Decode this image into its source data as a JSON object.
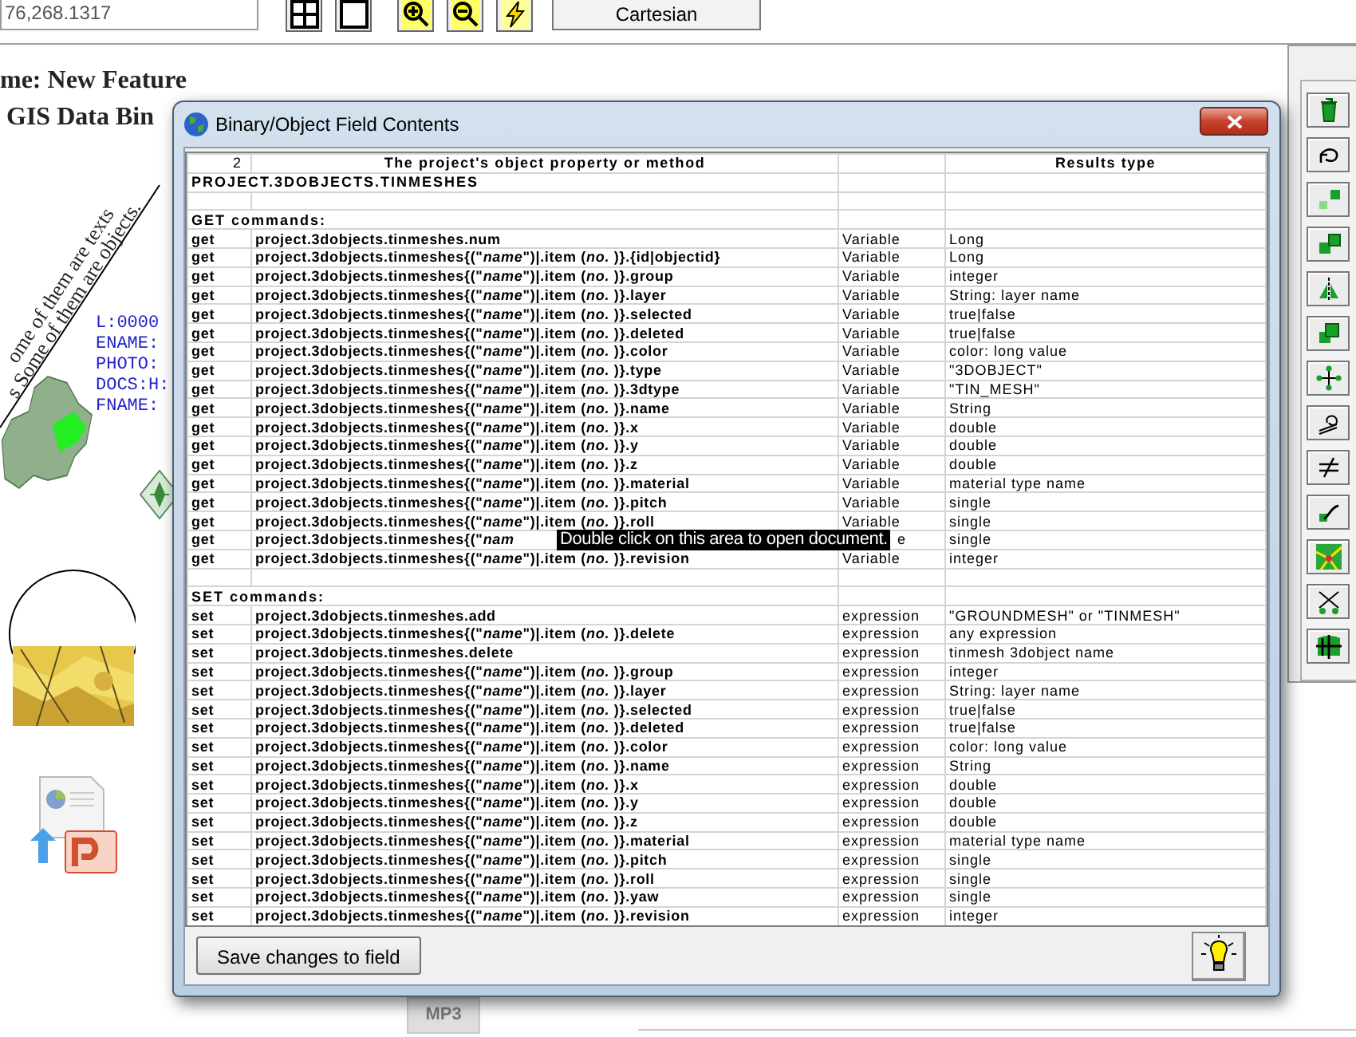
{
  "toolbar": {
    "coordinate": "76,268.1317",
    "projection_button": "Cartesian"
  },
  "canvas": {
    "heading_lines": [
      "me: New Feature",
      "GIS Data Bin"
    ],
    "rotated_texts": [
      "ome of them are texts",
      "s  Some of them are objects."
    ],
    "attribute_lines": [
      "L:0000",
      "ENAME:",
      "PHOTO:",
      "DOCS:H:",
      "FNAME:"
    ],
    "file_label": "MP3"
  },
  "dialog": {
    "title": "Binary/Object Field Contents",
    "header": {
      "column_1": "2",
      "column_2": "The project's object property or method",
      "column_4": "Results type"
    },
    "rows": [
      {
        "kind": "title",
        "text": "PROJECT.3DOBJECTS.TINMESHES"
      },
      {
        "kind": "blank"
      },
      {
        "kind": "section",
        "text": "GET commands:"
      },
      {
        "kind": "command",
        "verb": "get",
        "member": "project.3dobjects.tinmeshes.num",
        "access": "Variable",
        "result": "Long"
      },
      {
        "kind": "command",
        "verb": "get",
        "member": "project.3dobjects.tinmeshes{(\"*name*\")|.item (*no.* )}.{id|objectid}",
        "access": "Variable",
        "result": "Long"
      },
      {
        "kind": "command",
        "verb": "get",
        "member": "project.3dobjects.tinmeshes{(\"*name*\")|.item (*no.* )}.group",
        "access": "Variable",
        "result": "integer"
      },
      {
        "kind": "command",
        "verb": "get",
        "member": "project.3dobjects.tinmeshes{(\"*name*\")|.item (*no.* )}.layer",
        "access": "Variable",
        "result": "String: layer name"
      },
      {
        "kind": "command",
        "verb": "get",
        "member": "project.3dobjects.tinmeshes{(\"*name*\")|.item (*no.* )}.selected",
        "access": "Variable",
        "result": "true|false"
      },
      {
        "kind": "command",
        "verb": "get",
        "member": "project.3dobjects.tinmeshes{(\"*name*\")|.item (*no.* )}.deleted",
        "access": "Variable",
        "result": "true|false"
      },
      {
        "kind": "command",
        "verb": "get",
        "member": "project.3dobjects.tinmeshes{(\"*name*\")|.item (*no.* )}.color",
        "access": "Variable",
        "result": "color: long value"
      },
      {
        "kind": "command",
        "verb": "get",
        "member": "project.3dobjects.tinmeshes{(\"*name*\")|.item (*no.* )}.type",
        "access": "Variable",
        "result": "\"3DOBJECT\""
      },
      {
        "kind": "command",
        "verb": "get",
        "member": "project.3dobjects.tinmeshes{(\"*name*\")|.item (*no.* )}.3dtype",
        "access": "Variable",
        "result": "\"TIN_MESH\""
      },
      {
        "kind": "command",
        "verb": "get",
        "member": "project.3dobjects.tinmeshes{(\"*name*\")|.item (*no.* )}.name",
        "access": "Variable",
        "result": "String"
      },
      {
        "kind": "command",
        "verb": "get",
        "member": "project.3dobjects.tinmeshes{(\"*name*\")|.item (*no.* )}.x",
        "access": "Variable",
        "result": "double"
      },
      {
        "kind": "command",
        "verb": "get",
        "member": "project.3dobjects.tinmeshes{(\"*name*\")|.item (*no.* )}.y",
        "access": "Variable",
        "result": "double"
      },
      {
        "kind": "command",
        "verb": "get",
        "member": "project.3dobjects.tinmeshes{(\"*name*\")|.item (*no.* )}.z",
        "access": "Variable",
        "result": "double"
      },
      {
        "kind": "command",
        "verb": "get",
        "member": "project.3dobjects.tinmeshes{(\"*name*\")|.item (*no.* )}.material",
        "access": "Variable",
        "result": "material type name"
      },
      {
        "kind": "command",
        "verb": "get",
        "member": "project.3dobjects.tinmeshes{(\"*name*\")|.item (*no.* )}.pitch",
        "access": "Variable",
        "result": "single"
      },
      {
        "kind": "command",
        "verb": "get",
        "member": "project.3dobjects.tinmeshes{(\"*name*\")|.item (*no.* )}.roll",
        "access": "Variable",
        "result": "single"
      },
      {
        "kind": "covered",
        "verb": "get",
        "member": "project.3dobjects.tinmeshes{(\"*nam*",
        "access": "e",
        "result": "single"
      },
      {
        "kind": "command",
        "verb": "get",
        "member": "project.3dobjects.tinmeshes{(\"*name*\")|.item (*no.* )}.revision",
        "access": "Variable",
        "result": "integer"
      },
      {
        "kind": "blank"
      },
      {
        "kind": "section",
        "text": "SET commands:"
      },
      {
        "kind": "command",
        "verb": "set",
        "member": "project.3dobjects.tinmeshes.add",
        "access": "expression",
        "result": "\"GROUNDMESH\" or \"TINMESH\""
      },
      {
        "kind": "command",
        "verb": "set",
        "member": "project.3dobjects.tinmeshes{(\"*name*\")|.item (*no.* )}.delete",
        "access": "expression",
        "result": "any expression"
      },
      {
        "kind": "command",
        "verb": "set",
        "member": "project.3dobjects.tinmeshes.delete",
        "access": "expression",
        "result": "tinmesh 3dobject name"
      },
      {
        "kind": "command",
        "verb": "set",
        "member": "project.3dobjects.tinmeshes{(\"*name*\")|.item (*no.* )}.group",
        "access": "expression",
        "result": "integer"
      },
      {
        "kind": "command",
        "verb": "set",
        "member": "project.3dobjects.tinmeshes{(\"*name*\")|.item (*no.* )}.layer",
        "access": "expression",
        "result": "String: layer name"
      },
      {
        "kind": "command",
        "verb": "set",
        "member": "project.3dobjects.tinmeshes{(\"*name*\")|.item (*no.* )}.selected",
        "access": "expression",
        "result": "true|false"
      },
      {
        "kind": "command",
        "verb": "set",
        "member": "project.3dobjects.tinmeshes{(\"*name*\")|.item (*no.* )}.deleted",
        "access": "expression",
        "result": "true|false"
      },
      {
        "kind": "command",
        "verb": "set",
        "member": "project.3dobjects.tinmeshes{(\"*name*\")|.item (*no.* )}.color",
        "access": "expression",
        "result": "color: long value"
      },
      {
        "kind": "command",
        "verb": "set",
        "member": "project.3dobjects.tinmeshes{(\"*name*\")|.item (*no.* )}.name",
        "access": "expression",
        "result": "String"
      },
      {
        "kind": "command",
        "verb": "set",
        "member": "project.3dobjects.tinmeshes{(\"*name*\")|.item (*no.* )}.x",
        "access": "expression",
        "result": "double"
      },
      {
        "kind": "command",
        "verb": "set",
        "member": "project.3dobjects.tinmeshes{(\"*name*\")|.item (*no.* )}.y",
        "access": "expression",
        "result": "double"
      },
      {
        "kind": "command",
        "verb": "set",
        "member": "project.3dobjects.tinmeshes{(\"*name*\")|.item (*no.* )}.z",
        "access": "expression",
        "result": "double"
      },
      {
        "kind": "command",
        "verb": "set",
        "member": "project.3dobjects.tinmeshes{(\"*name*\")|.item (*no.* )}.material",
        "access": "expression",
        "result": "material type name"
      },
      {
        "kind": "command",
        "verb": "set",
        "member": "project.3dobjects.tinmeshes{(\"*name*\")|.item (*no.* )}.pitch",
        "access": "expression",
        "result": "single"
      },
      {
        "kind": "command",
        "verb": "set",
        "member": "project.3dobjects.tinmeshes{(\"*name*\")|.item (*no.* )}.roll",
        "access": "expression",
        "result": "single"
      },
      {
        "kind": "command",
        "verb": "set",
        "member": "project.3dobjects.tinmeshes{(\"*name*\")|.item (*no.* )}.yaw",
        "access": "expression",
        "result": "single"
      },
      {
        "kind": "command",
        "verb": "set",
        "member": "project.3dobjects.tinmeshes{(\"*name*\")|.item (*no.* )}.revision",
        "access": "expression",
        "result": "integer"
      }
    ],
    "tooltip": "Double click on this area to open document.",
    "save_button": "Save changes to field"
  }
}
